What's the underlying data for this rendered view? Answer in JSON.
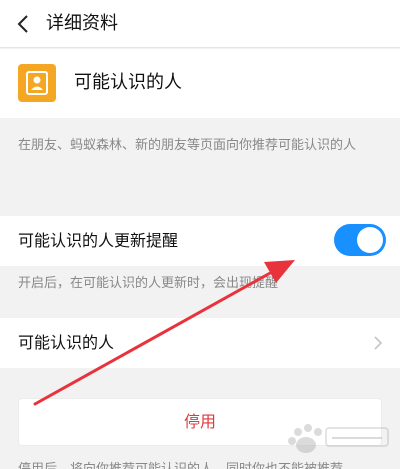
{
  "header": {
    "title": "详细资料"
  },
  "profile": {
    "name": "可能认识的人"
  },
  "description": "在朋友、蚂蚁森林、新的朋友等页面向你推荐可能认识的人",
  "update_setting": {
    "label": "可能认识的人更新提醒",
    "enabled": true,
    "hint": "开启后，在可能认识的人更新时，会出现提醒"
  },
  "link_row": {
    "label": "可能认识的人"
  },
  "disable_button": {
    "label": "停用"
  },
  "footer_text": "停用后，将向你推荐可能认识的人，同时你也不能被推荐",
  "watermark": {
    "text": "Baidu 经验"
  },
  "colors": {
    "accent": "#1890ff",
    "icon_bg": "#f5a623",
    "danger": "#e0383e",
    "arrow": "#e8323c"
  }
}
